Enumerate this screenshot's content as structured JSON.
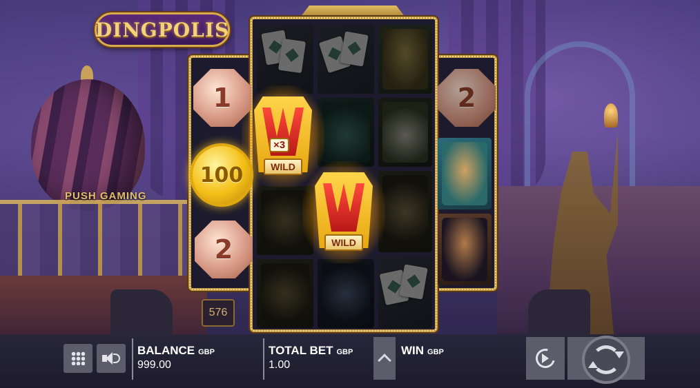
{
  "game": {
    "logo_text": "DINGPOLIS",
    "sign_text": "PUSH GAMING"
  },
  "reels": {
    "side_left_coins": [
      "1",
      "100",
      "2"
    ],
    "side_right_coins": [
      "2"
    ],
    "wild_label": "WILD",
    "wild_multiplier": "×3",
    "ways_count": "576"
  },
  "bottom_bar": {
    "balance_label": "BALANCE",
    "balance_currency": "GBP",
    "balance_value": "999.00",
    "total_bet_label": "TOTAL BET",
    "total_bet_currency": "GBP",
    "total_bet_value": "1.00",
    "win_label": "WIN",
    "win_currency": "GBP",
    "win_value": ""
  },
  "icons": {
    "menu": "grid-icon",
    "sound": "speaker-icon",
    "bet_up": "chevron-up-icon",
    "autoplay": "autoplay-icon",
    "spin": "spin-icon"
  },
  "colors": {
    "gold_frame": "#c49a44",
    "bar_bg": "#1c1a2a",
    "button_gray": "#5d5c6a"
  }
}
